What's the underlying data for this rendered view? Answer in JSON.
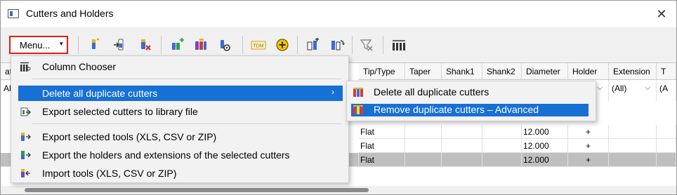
{
  "window": {
    "title": "Cutters and Holders",
    "close_glyph": "✕",
    "icon": "window-icon"
  },
  "toolbar": {
    "menu_label": "Menu...",
    "menu_arrow": "▾",
    "buttons": [
      "new-cutter-icon",
      "import-cutter-icon",
      "delete-cutter-icon",
      "add-tool-icon",
      "copy-tool-icon",
      "tool-settings-icon",
      "tdm-icon",
      "add-circle-icon",
      "holder-icon",
      "swap-holder-icon",
      "clear-filter-icon",
      "column-chooser-icon"
    ],
    "tdm_label": "TDM"
  },
  "grid": {
    "columns": [
      "Tip/Type",
      "Taper",
      "Shank1",
      "Shank2",
      "Diameter",
      "Holder",
      "Extension",
      "T"
    ],
    "left_partial_header": "at",
    "filters": {
      "left_partial": "All)",
      "holder": "",
      "extension": "(All)",
      "t": "(A"
    },
    "rows": [
      {
        "tip": "Flat",
        "diameter": "12.000",
        "holder": "+",
        "selected": false
      },
      {
        "tip": "Flat",
        "diameter": "12.000",
        "holder": "+",
        "selected": false
      },
      {
        "tip": "Flat",
        "diameter": "12.000",
        "holder": "+",
        "selected": true
      }
    ],
    "filter_arrow": "⌵"
  },
  "menu": {
    "items": [
      {
        "label": "Column Chooser",
        "icon": "column-chooser-icon"
      },
      {
        "label": "Delete all duplicate cutters",
        "icon": "",
        "submenu_arrow": "›"
      },
      {
        "label": "Export selected cutters to library file",
        "icon": "export-library-icon"
      },
      {
        "label": "Export selected tools (XLS, CSV or ZIP)",
        "icon": "export-tools-icon"
      },
      {
        "label": "Export the holders and extensions of the selected cutters",
        "icon": "export-holders-icon"
      },
      {
        "label": "Import tools (XLS, CSV or ZIP)",
        "icon": "import-tools-icon"
      }
    ]
  },
  "submenu": {
    "items": [
      {
        "label": "Delete all duplicate cutters",
        "icon": "duplicate-cutters-icon"
      },
      {
        "label": "Remove duplicate cutters – Advanced",
        "icon": "duplicate-cutters-advanced-icon"
      }
    ]
  },
  "colors": {
    "highlight": "#1770d4",
    "menu_border_red": "#e01e1e",
    "selected_row": "#bfbfbf"
  }
}
